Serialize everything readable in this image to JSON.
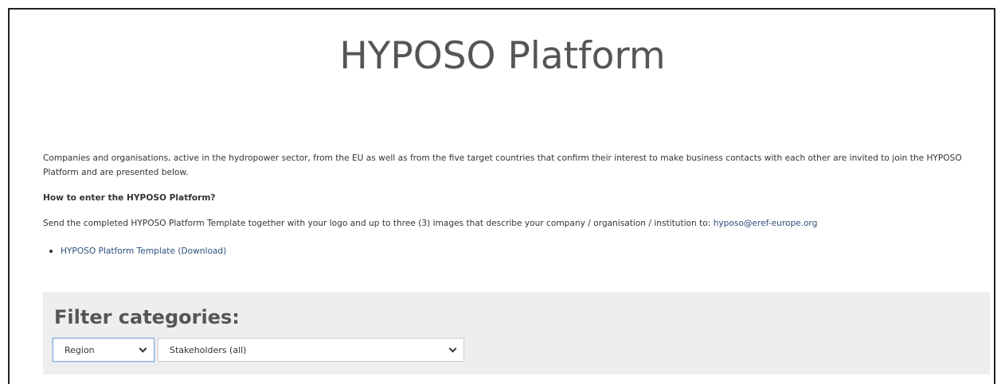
{
  "page": {
    "title": "HYPOSO Platform"
  },
  "intro": {
    "text": "Companies and organisations, active in the hydropower sector, from the EU as well as from the five target countries that confirm their interest to make business contacts with each other are invited to join the HYPOSO Platform and are presented below.",
    "howto_heading": "How to enter the HYPOSO Platform?",
    "send_text": "Send the completed HYPOSO Platform Template together with your logo and up to three (3) images that describe your company / organisation / institution to: ",
    "email": "hyposo@eref-europe.org",
    "template_link": "HYPOSO Platform Template (Download)"
  },
  "filter": {
    "title": "Filter categories:",
    "region_select": "Region",
    "stakeholders_select": "Stakeholders (all)"
  },
  "icons": {
    "select_arrow": "chevron-down-icon",
    "bullet": "bullet-icon"
  },
  "colors": {
    "link": "#2c4f7c",
    "panel_bg": "#eeeeee",
    "title": "#555555"
  }
}
